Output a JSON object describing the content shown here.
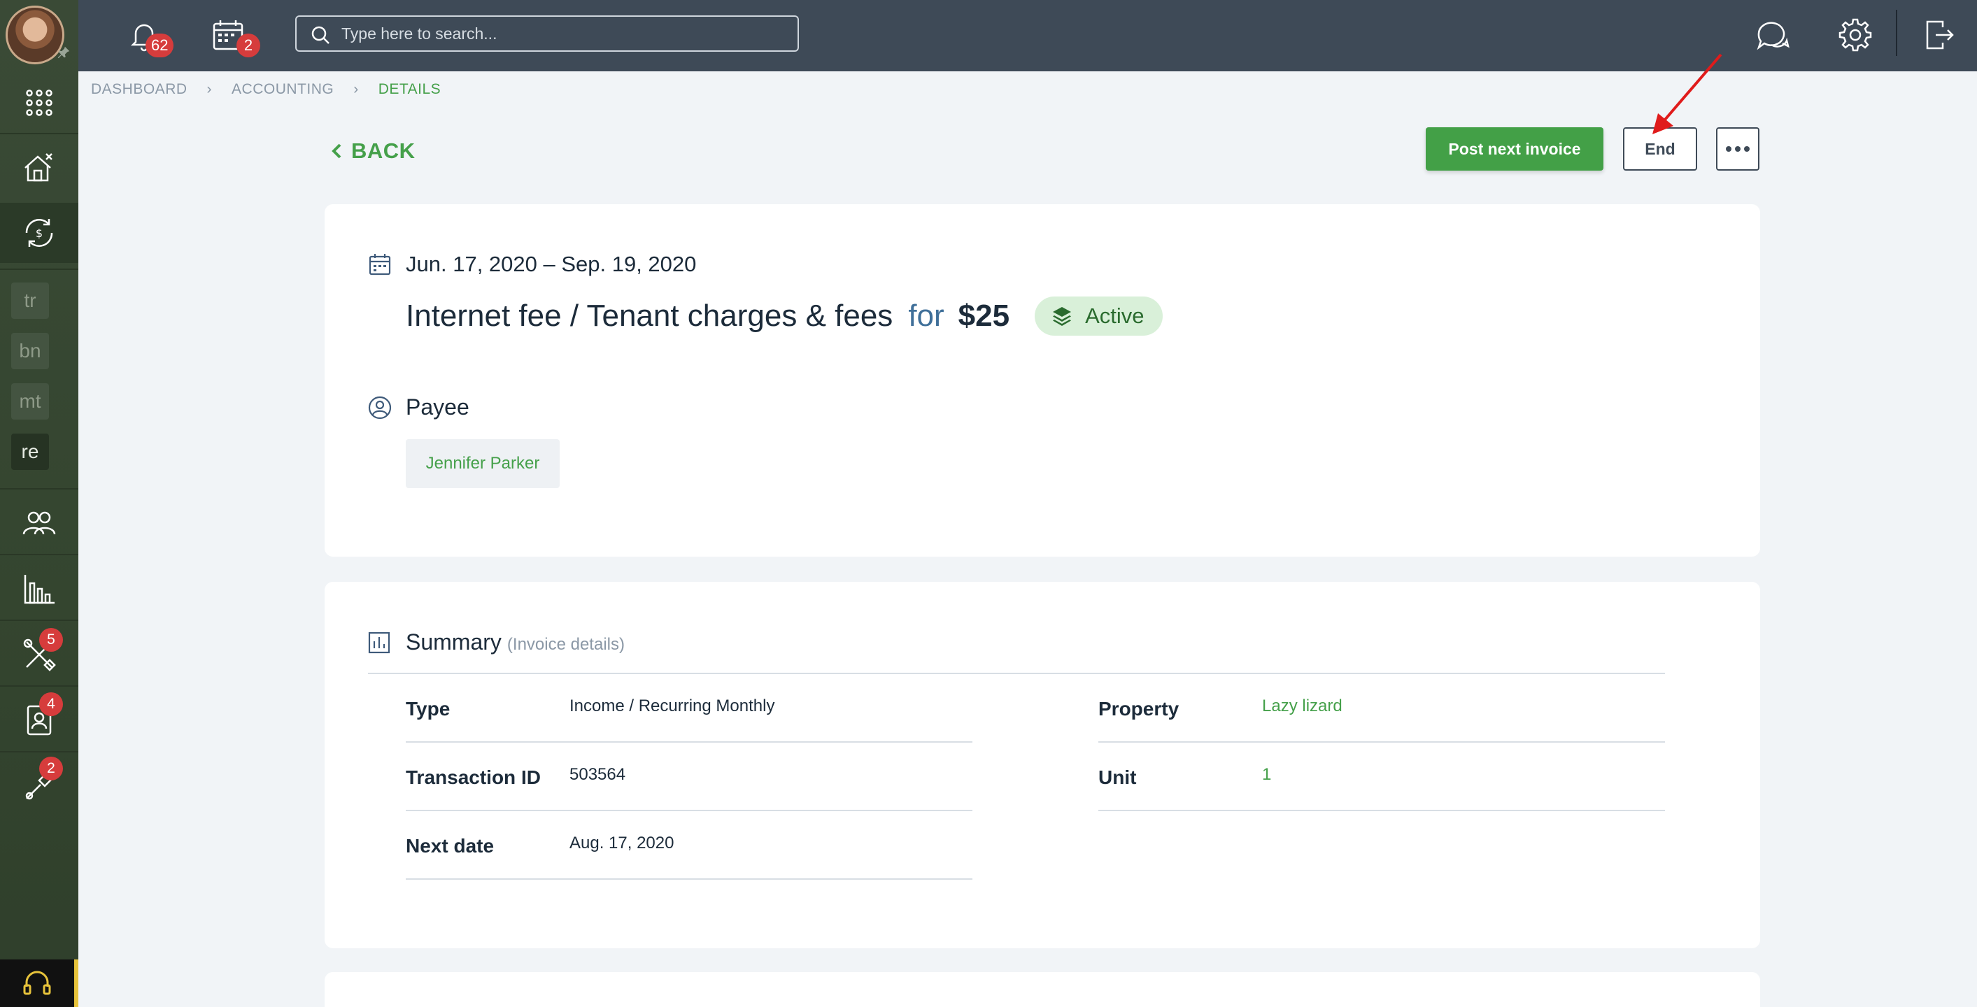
{
  "topbar": {
    "notifications_count": "62",
    "calendar_count": "2",
    "search_placeholder": "Type here to search..."
  },
  "sidebar": {
    "chips": [
      "tr",
      "bn",
      "mt",
      "re"
    ],
    "maintenance_badge": "5",
    "contacts_badge": "4",
    "tools_badge": "2"
  },
  "breadcrumb": {
    "items": [
      "DASHBOARD",
      "ACCOUNTING",
      "DETAILS"
    ]
  },
  "actions": {
    "back_label": "BACK",
    "post_label": "Post next invoice",
    "end_label": "End"
  },
  "transaction": {
    "date_range": "Jun. 17, 2020 – Sep. 19, 2020",
    "title": "Internet fee / Tenant charges & fees",
    "for_label": "for",
    "amount": "$25",
    "status": "Active",
    "payee_label": "Payee",
    "payee_name": "Jennifer Parker"
  },
  "summary": {
    "title": "Summary",
    "subtitle": "(Invoice details)",
    "left": [
      {
        "label": "Type",
        "value": "Income / Recurring Monthly"
      },
      {
        "label": "Transaction ID",
        "value": "503564"
      },
      {
        "label": "Next date",
        "value": "Aug. 17, 2020"
      }
    ],
    "right": [
      {
        "label": "Property",
        "value": "Lazy lizard"
      },
      {
        "label": "Unit",
        "value": "1"
      }
    ]
  },
  "colors": {
    "accent_green": "#43a047",
    "topbar": "#3e4a57",
    "sidebar": "#3a4a36",
    "badge_red": "#d63c3c"
  }
}
